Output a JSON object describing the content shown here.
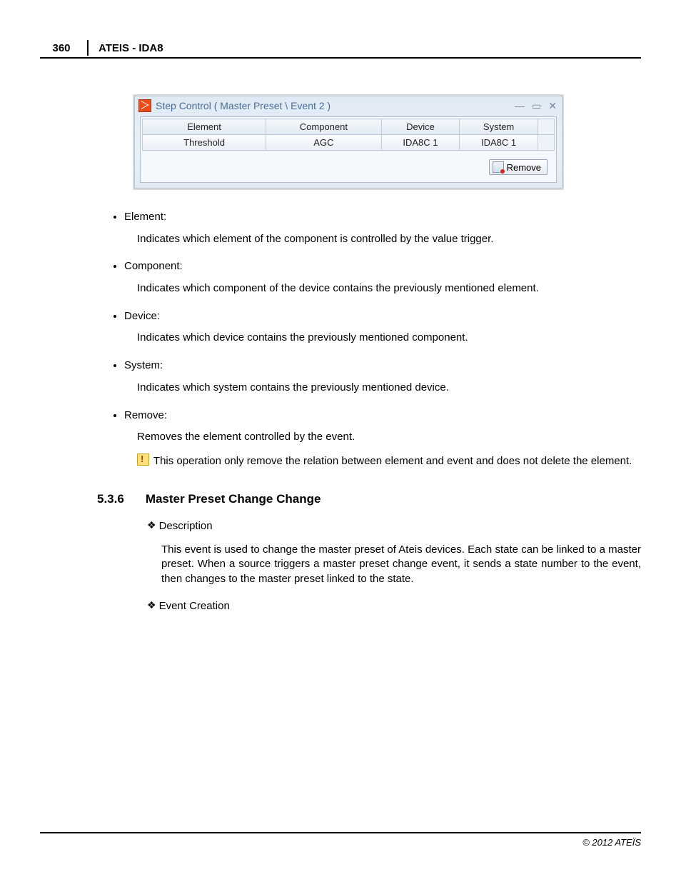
{
  "header": {
    "page_number": "360",
    "doc_title": "ATEIS - IDA8"
  },
  "dialog": {
    "title": "Step Control ( Master Preset \\ Event 2 )",
    "columns": [
      "Element",
      "Component",
      "Device",
      "System"
    ],
    "row": [
      "Threshold",
      "AGC",
      "IDA8C 1",
      "IDA8C 1"
    ],
    "remove_label": "Remove"
  },
  "definitions": [
    {
      "term": "Element:",
      "desc": "Indicates which element of the component is controlled by the value trigger."
    },
    {
      "term": "Component:",
      "desc": "Indicates which component of the device contains the previously mentioned element."
    },
    {
      "term": "Device:",
      "desc": "Indicates which device contains the previously mentioned component."
    },
    {
      "term": "System:",
      "desc": "Indicates which system contains the previously mentioned device."
    },
    {
      "term": "Remove:",
      "desc": "Removes the element controlled by the event."
    }
  ],
  "warning": "This operation only remove the relation between element and event and does not delete the element.",
  "section": {
    "number": "5.3.6",
    "title": "Master Preset Change Change",
    "sub1_label": "Description",
    "sub1_text": "This event is used to change the master preset of Ateis devices. Each state can be linked to a master preset. When a source triggers a master preset change event, it sends a state number to the event, then changes to the master preset linked to the state.",
    "sub2_label": "Event Creation"
  },
  "footer": "© 2012 ATEÏS"
}
